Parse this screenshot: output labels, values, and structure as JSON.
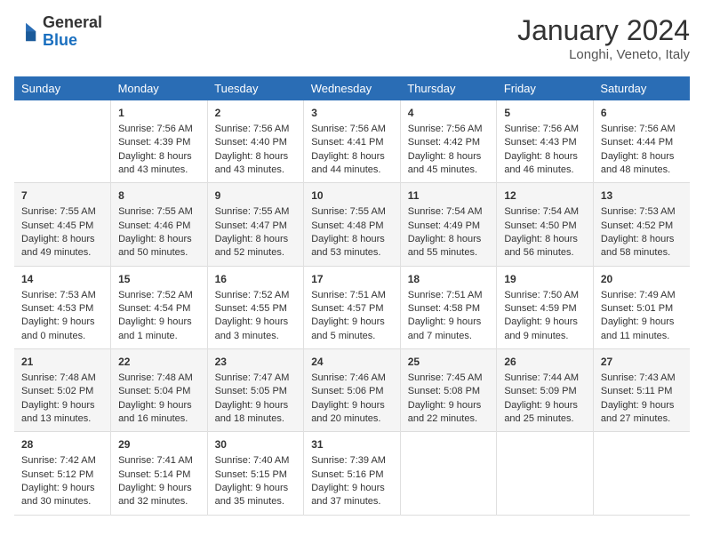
{
  "header": {
    "logo_general": "General",
    "logo_blue": "Blue",
    "month_title": "January 2024",
    "location": "Longhi, Veneto, Italy"
  },
  "columns": [
    "Sunday",
    "Monday",
    "Tuesday",
    "Wednesday",
    "Thursday",
    "Friday",
    "Saturday"
  ],
  "weeks": [
    [
      {
        "day": "",
        "sunrise": "",
        "sunset": "",
        "daylight": ""
      },
      {
        "day": "1",
        "sunrise": "Sunrise: 7:56 AM",
        "sunset": "Sunset: 4:39 PM",
        "daylight": "Daylight: 8 hours and 43 minutes."
      },
      {
        "day": "2",
        "sunrise": "Sunrise: 7:56 AM",
        "sunset": "Sunset: 4:40 PM",
        "daylight": "Daylight: 8 hours and 43 minutes."
      },
      {
        "day": "3",
        "sunrise": "Sunrise: 7:56 AM",
        "sunset": "Sunset: 4:41 PM",
        "daylight": "Daylight: 8 hours and 44 minutes."
      },
      {
        "day": "4",
        "sunrise": "Sunrise: 7:56 AM",
        "sunset": "Sunset: 4:42 PM",
        "daylight": "Daylight: 8 hours and 45 minutes."
      },
      {
        "day": "5",
        "sunrise": "Sunrise: 7:56 AM",
        "sunset": "Sunset: 4:43 PM",
        "daylight": "Daylight: 8 hours and 46 minutes."
      },
      {
        "day": "6",
        "sunrise": "Sunrise: 7:56 AM",
        "sunset": "Sunset: 4:44 PM",
        "daylight": "Daylight: 8 hours and 48 minutes."
      }
    ],
    [
      {
        "day": "7",
        "sunrise": "Sunrise: 7:55 AM",
        "sunset": "Sunset: 4:45 PM",
        "daylight": "Daylight: 8 hours and 49 minutes."
      },
      {
        "day": "8",
        "sunrise": "Sunrise: 7:55 AM",
        "sunset": "Sunset: 4:46 PM",
        "daylight": "Daylight: 8 hours and 50 minutes."
      },
      {
        "day": "9",
        "sunrise": "Sunrise: 7:55 AM",
        "sunset": "Sunset: 4:47 PM",
        "daylight": "Daylight: 8 hours and 52 minutes."
      },
      {
        "day": "10",
        "sunrise": "Sunrise: 7:55 AM",
        "sunset": "Sunset: 4:48 PM",
        "daylight": "Daylight: 8 hours and 53 minutes."
      },
      {
        "day": "11",
        "sunrise": "Sunrise: 7:54 AM",
        "sunset": "Sunset: 4:49 PM",
        "daylight": "Daylight: 8 hours and 55 minutes."
      },
      {
        "day": "12",
        "sunrise": "Sunrise: 7:54 AM",
        "sunset": "Sunset: 4:50 PM",
        "daylight": "Daylight: 8 hours and 56 minutes."
      },
      {
        "day": "13",
        "sunrise": "Sunrise: 7:53 AM",
        "sunset": "Sunset: 4:52 PM",
        "daylight": "Daylight: 8 hours and 58 minutes."
      }
    ],
    [
      {
        "day": "14",
        "sunrise": "Sunrise: 7:53 AM",
        "sunset": "Sunset: 4:53 PM",
        "daylight": "Daylight: 9 hours and 0 minutes."
      },
      {
        "day": "15",
        "sunrise": "Sunrise: 7:52 AM",
        "sunset": "Sunset: 4:54 PM",
        "daylight": "Daylight: 9 hours and 1 minute."
      },
      {
        "day": "16",
        "sunrise": "Sunrise: 7:52 AM",
        "sunset": "Sunset: 4:55 PM",
        "daylight": "Daylight: 9 hours and 3 minutes."
      },
      {
        "day": "17",
        "sunrise": "Sunrise: 7:51 AM",
        "sunset": "Sunset: 4:57 PM",
        "daylight": "Daylight: 9 hours and 5 minutes."
      },
      {
        "day": "18",
        "sunrise": "Sunrise: 7:51 AM",
        "sunset": "Sunset: 4:58 PM",
        "daylight": "Daylight: 9 hours and 7 minutes."
      },
      {
        "day": "19",
        "sunrise": "Sunrise: 7:50 AM",
        "sunset": "Sunset: 4:59 PM",
        "daylight": "Daylight: 9 hours and 9 minutes."
      },
      {
        "day": "20",
        "sunrise": "Sunrise: 7:49 AM",
        "sunset": "Sunset: 5:01 PM",
        "daylight": "Daylight: 9 hours and 11 minutes."
      }
    ],
    [
      {
        "day": "21",
        "sunrise": "Sunrise: 7:48 AM",
        "sunset": "Sunset: 5:02 PM",
        "daylight": "Daylight: 9 hours and 13 minutes."
      },
      {
        "day": "22",
        "sunrise": "Sunrise: 7:48 AM",
        "sunset": "Sunset: 5:04 PM",
        "daylight": "Daylight: 9 hours and 16 minutes."
      },
      {
        "day": "23",
        "sunrise": "Sunrise: 7:47 AM",
        "sunset": "Sunset: 5:05 PM",
        "daylight": "Daylight: 9 hours and 18 minutes."
      },
      {
        "day": "24",
        "sunrise": "Sunrise: 7:46 AM",
        "sunset": "Sunset: 5:06 PM",
        "daylight": "Daylight: 9 hours and 20 minutes."
      },
      {
        "day": "25",
        "sunrise": "Sunrise: 7:45 AM",
        "sunset": "Sunset: 5:08 PM",
        "daylight": "Daylight: 9 hours and 22 minutes."
      },
      {
        "day": "26",
        "sunrise": "Sunrise: 7:44 AM",
        "sunset": "Sunset: 5:09 PM",
        "daylight": "Daylight: 9 hours and 25 minutes."
      },
      {
        "day": "27",
        "sunrise": "Sunrise: 7:43 AM",
        "sunset": "Sunset: 5:11 PM",
        "daylight": "Daylight: 9 hours and 27 minutes."
      }
    ],
    [
      {
        "day": "28",
        "sunrise": "Sunrise: 7:42 AM",
        "sunset": "Sunset: 5:12 PM",
        "daylight": "Daylight: 9 hours and 30 minutes."
      },
      {
        "day": "29",
        "sunrise": "Sunrise: 7:41 AM",
        "sunset": "Sunset: 5:14 PM",
        "daylight": "Daylight: 9 hours and 32 minutes."
      },
      {
        "day": "30",
        "sunrise": "Sunrise: 7:40 AM",
        "sunset": "Sunset: 5:15 PM",
        "daylight": "Daylight: 9 hours and 35 minutes."
      },
      {
        "day": "31",
        "sunrise": "Sunrise: 7:39 AM",
        "sunset": "Sunset: 5:16 PM",
        "daylight": "Daylight: 9 hours and 37 minutes."
      },
      {
        "day": "",
        "sunrise": "",
        "sunset": "",
        "daylight": ""
      },
      {
        "day": "",
        "sunrise": "",
        "sunset": "",
        "daylight": ""
      },
      {
        "day": "",
        "sunrise": "",
        "sunset": "",
        "daylight": ""
      }
    ]
  ]
}
